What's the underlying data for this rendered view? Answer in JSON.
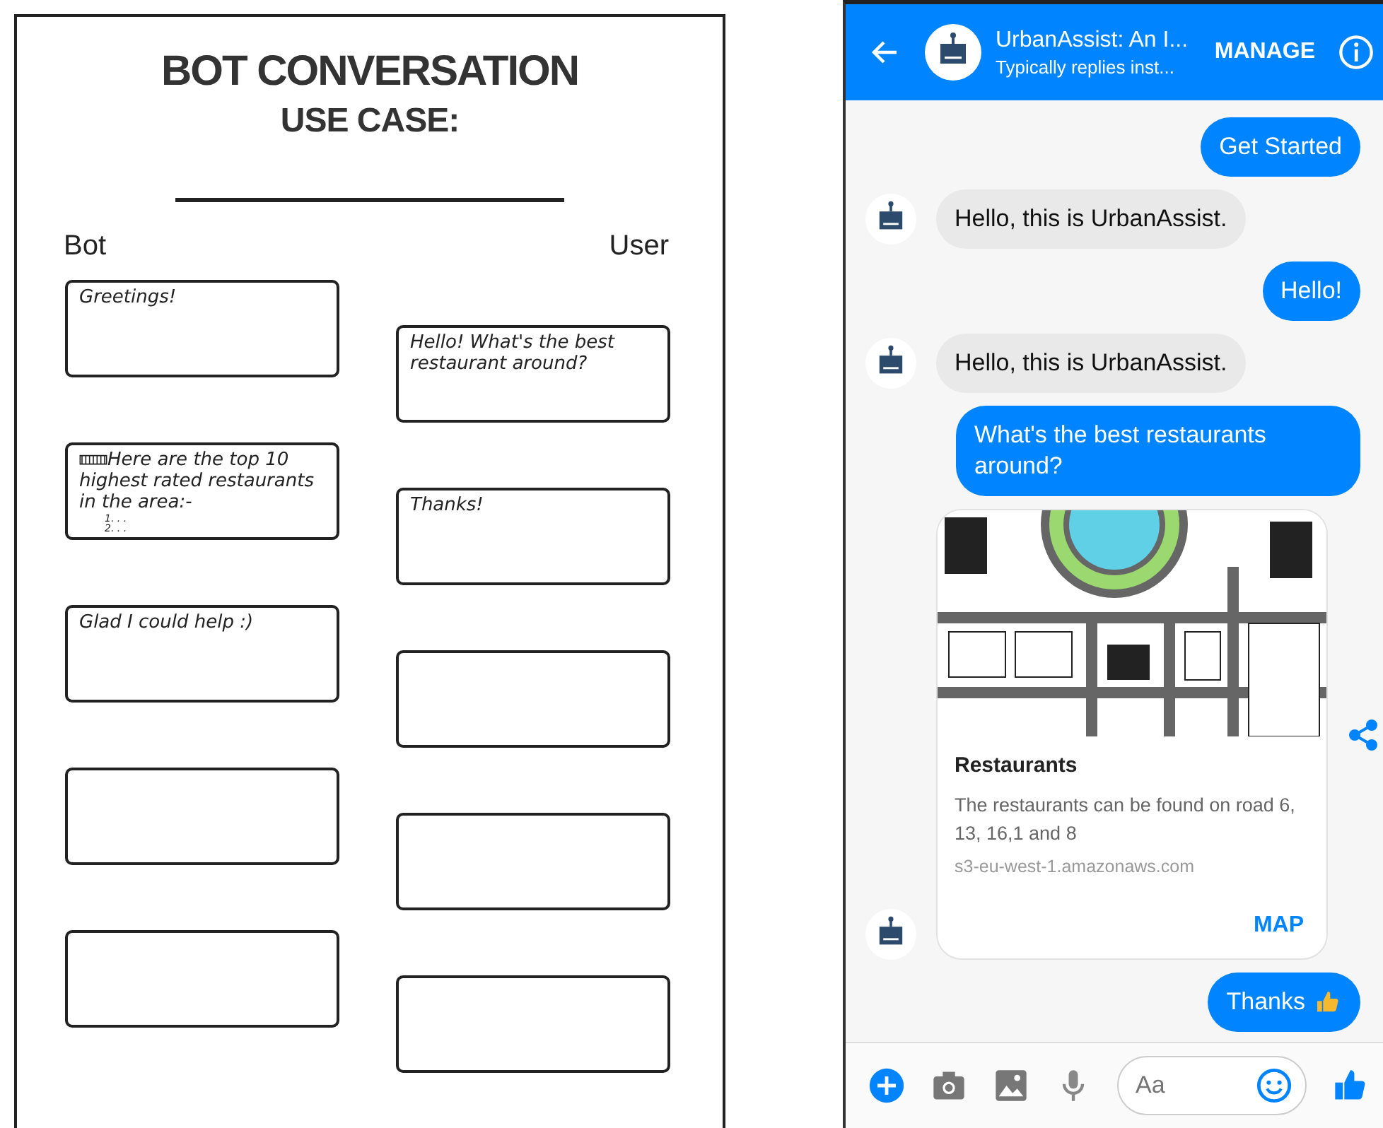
{
  "sheet": {
    "title": "BOT CONVERSATION",
    "subtitle": "USE CASE:",
    "columns": [
      "Bot",
      "User"
    ],
    "bot_boxes": [
      {
        "kind": "written",
        "text": "Greetings!"
      },
      {
        "kind": "written",
        "text": "Here are the top 10 highest rated restaurants in the area:-",
        "struck": true,
        "list": [
          "1. . .",
          "2. . ."
        ]
      },
      {
        "kind": "written",
        "text": "Glad I could help :)"
      },
      {
        "kind": "blank"
      },
      {
        "kind": "blank"
      }
    ],
    "user_boxes": [
      {
        "kind": "written",
        "text": "Hello! What's the best restaurant around?"
      },
      {
        "kind": "written",
        "text": "Thanks!"
      },
      {
        "kind": "blank"
      },
      {
        "kind": "blank"
      },
      {
        "kind": "blank"
      }
    ]
  },
  "phone": {
    "header": {
      "title": "UrbanAssist: An I...",
      "subtitle": "Typically replies inst...",
      "action": "MANAGE"
    },
    "messages": [
      {
        "kind": "user",
        "text": "Get Started"
      },
      {
        "kind": "bot",
        "text": "Hello, this is UrbanAssist."
      },
      {
        "kind": "user",
        "text": "Hello!"
      },
      {
        "kind": "bot",
        "text": "Hello, this is UrbanAssist."
      },
      {
        "kind": "user",
        "text": "What's the best restaurants around?"
      },
      {
        "kind": "card",
        "title": "Restaurants",
        "description": "The restaurants can be found on road 6, 13, 16,1 and 8",
        "source": "s3-eu-west-1.amazonaws.com",
        "button": "MAP"
      },
      {
        "kind": "user",
        "text": "Thanks",
        "thumb": true
      }
    ],
    "composer": {
      "placeholder": "Aa"
    }
  }
}
